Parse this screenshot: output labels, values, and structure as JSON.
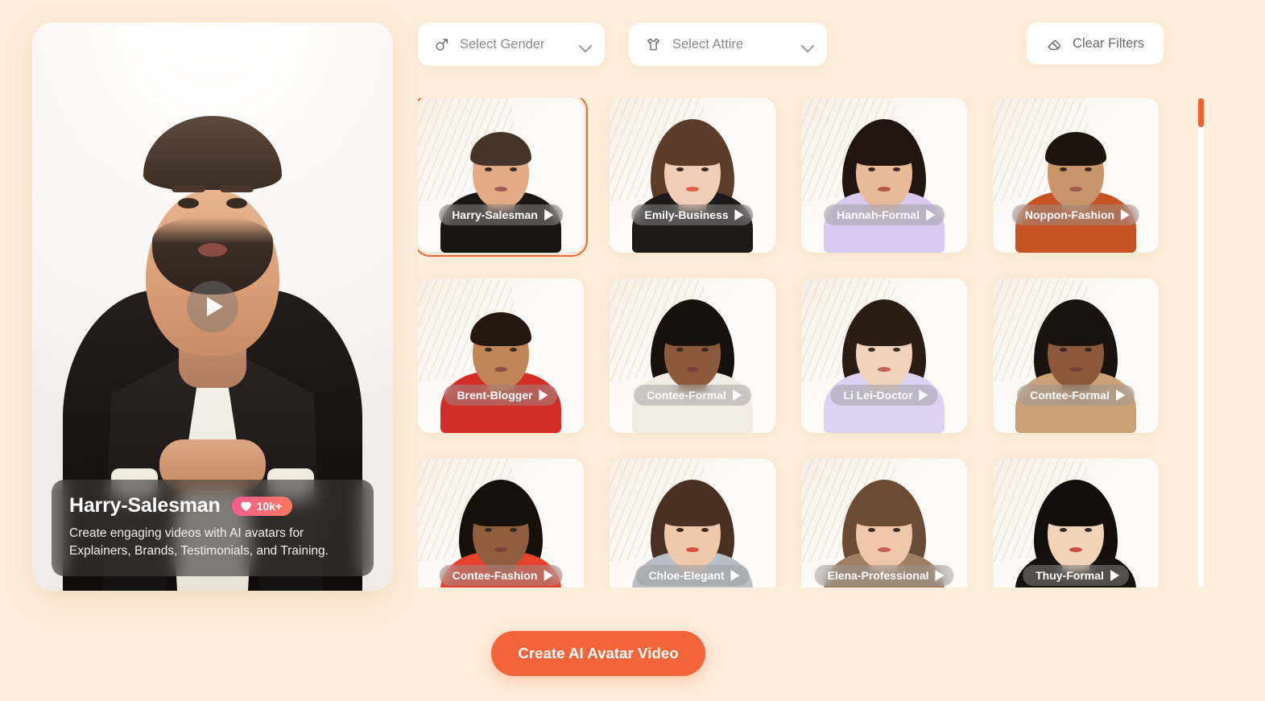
{
  "background_color": "#FDEEDB",
  "accent_color": "#F4643A",
  "preview": {
    "avatar_name": "Harry-Salesman",
    "description": "Create engaging videos with AI avatars for Explainers, Brands, Testimonials, and Training.",
    "like_count": "10k+",
    "heart_icon": "heart-icon",
    "play_icon": "play-icon"
  },
  "filters": {
    "gender": {
      "icon": "male-gender-icon",
      "label": "Select Gender",
      "chevron": "chevron-down-icon"
    },
    "attire": {
      "icon": "tshirt-icon",
      "label": "Select Attire",
      "chevron": "chevron-down-icon"
    },
    "clear": {
      "icon": "eraser-icon",
      "label": "Clear Filters"
    }
  },
  "avatars": [
    {
      "name": "Harry-Salesman",
      "selected": true,
      "skin": "#e2ab85",
      "hair": "#463428",
      "outfit": "#1a1614",
      "lip": "#a05a52",
      "hair_long": false
    },
    {
      "name": "Emily-Business",
      "selected": false,
      "skin": "#f0cdb6",
      "hair": "#5b3d2a",
      "outfit": "#1d1a19",
      "lip": "#e0604a",
      "hair_long": true
    },
    {
      "name": "Hannah-Formal",
      "selected": false,
      "skin": "#e8bb98",
      "hair": "#20160f",
      "outfit": "#d9c9f0",
      "lip": "#b5564c",
      "hair_long": true
    },
    {
      "name": "Noppon-Fashion",
      "selected": false,
      "skin": "#c99469",
      "hair": "#1d140e",
      "outfit": "#c75223",
      "lip": "#9c5a48",
      "hair_long": false
    },
    {
      "name": "Brent-Blogger",
      "selected": false,
      "skin": "#c08657",
      "hair": "#241710",
      "outfit": "#d32d27",
      "lip": "#8f5142",
      "hair_long": false
    },
    {
      "name": "Contee-Formal",
      "selected": false,
      "skin": "#8b5a3c",
      "hair": "#18100b",
      "outfit": "#f2ece4",
      "lip": "#7a3f38",
      "hair_long": true
    },
    {
      "name": "Li Lei-Doctor",
      "selected": false,
      "skin": "#f0d2bb",
      "hair": "#2a1d14",
      "outfit": "#ddd2f2",
      "lip": "#c4635a",
      "hair_long": true
    },
    {
      "name": "Contee-Formal",
      "selected": false,
      "skin": "#8a583a",
      "hair": "#1a120c",
      "outfit": "#c9a077",
      "lip": "#7c4038",
      "hair_long": true
    },
    {
      "name": "Contee-Fashion",
      "selected": false,
      "skin": "#8e5e3f",
      "hair": "#170f0a",
      "outfit": "#e8402a",
      "lip": "#7f4239",
      "hair_long": true
    },
    {
      "name": "Chloe-Elegant",
      "selected": false,
      "skin": "#eec9ac",
      "hair": "#4a3022",
      "outfit": "#b9bfc6",
      "lip": "#d8513f",
      "hair_long": true
    },
    {
      "name": "Elena-Professional",
      "selected": false,
      "skin": "#eec7ab",
      "hair": "#6a4b33",
      "outfit": "#9f7f63",
      "lip": "#bf6455",
      "hair_long": true
    },
    {
      "name": "Thuy-Formal",
      "selected": false,
      "skin": "#f0d3b8",
      "hair": "#140d09",
      "outfit": "#17120f",
      "lip": "#cf4f3e",
      "hair_long": true
    }
  ],
  "cta": {
    "label": "Create AI Avatar Video"
  },
  "scrollbar": {
    "thumb_color": "#F4612F",
    "position": "top"
  }
}
